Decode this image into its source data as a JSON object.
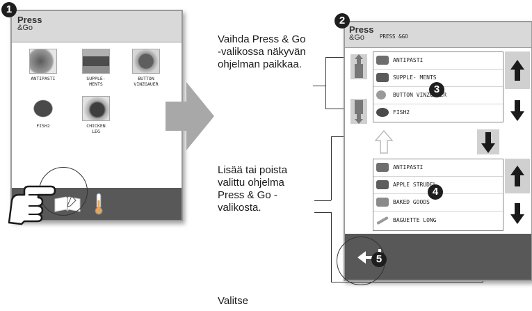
{
  "steps": [
    "1",
    "2",
    "3",
    "4",
    "5"
  ],
  "screen1": {
    "brand_line1": "Press",
    "brand_line2": "&Go",
    "tiles": [
      {
        "label": "ANTIPASTI"
      },
      {
        "label": "SUPPLE-\nMENTS"
      },
      {
        "label": "BUTTON\nVINZGAUER"
      },
      {
        "label": "FISH2"
      },
      {
        "label": "CHICKEN\nLEG"
      }
    ],
    "bottom_icons": [
      "book-edit-icon",
      "thermometer-icon"
    ]
  },
  "screen2": {
    "brand_line1": "Press",
    "brand_line2": "&Go",
    "header_text": "PRESS &GO",
    "top_list": [
      "ANTIPASTI",
      "SUPPLE- MENTS",
      "BUTTON VINZGAUER",
      "FISH2"
    ],
    "bottom_list": [
      "ANTIPASTI",
      "APPLE STRUDEL",
      "BAKED GOODS",
      "BAGUETTE LONG"
    ],
    "icons": [
      "move-up-icon",
      "move-down-icon",
      "arrow-up-icon",
      "arrow-down-icon",
      "add-up-icon",
      "remove-down-icon",
      "back-icon"
    ]
  },
  "callouts": {
    "reorder": "Vaihda Press & Go -valikossa näkyvän ohjelman paikkaa.",
    "add_remove": "Lisää tai poista valittu ohjelma Press & Go -valikosta.",
    "select": "Valitse"
  },
  "colors": {
    "screen_header": "#d9d9d9",
    "bottom_bar": "#585858",
    "badge": "#1e1e1e"
  }
}
